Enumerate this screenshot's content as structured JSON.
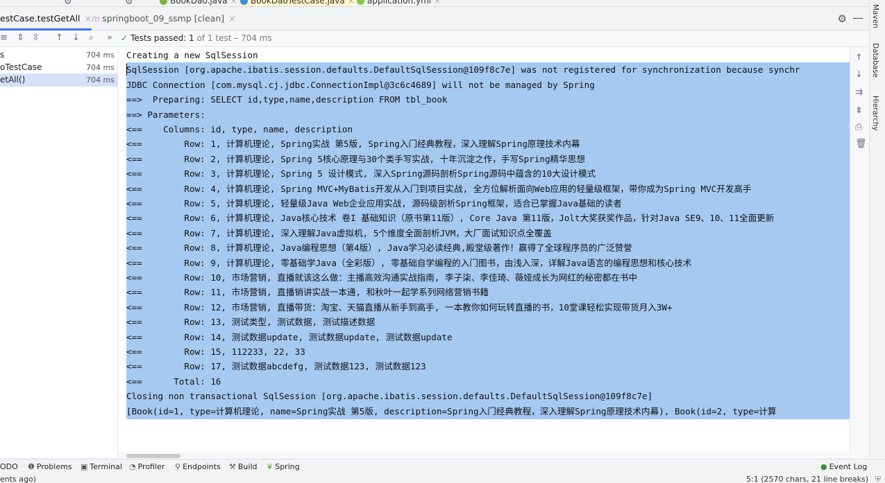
{
  "editor_tabs": [
    "BookDao.java",
    "BookDaoTestCase.java",
    "application.yml"
  ],
  "run_tabs": [
    {
      "label": "estCase.testGetAll"
    },
    {
      "label": "springboot_09_ssmp [clean]"
    }
  ],
  "test_status": {
    "passed_label": "Tests passed:",
    "count": "1",
    "detail": "of 1 test – 704 ms"
  },
  "tree": [
    {
      "name": "s",
      "time": "704 ms"
    },
    {
      "name": "oTestCase",
      "time": "704 ms"
    },
    {
      "name": "etAll()",
      "time": "704 ms"
    }
  ],
  "console_lines": [
    "Creating a new SqlSession",
    "SqlSession [org.apache.ibatis.session.defaults.DefaultSqlSession@109f8c7e] was not registered for synchronization because synchr",
    "JDBC Connection [com.mysql.cj.jdbc.ConnectionImpl@3c6c4689] will not be managed by Spring",
    "==>  Preparing: SELECT id,type,name,description FROM tbl_book",
    "==> Parameters: ",
    "<==    Columns: id, type, name, description",
    "<==        Row: 1, 计算机理论, Spring实战 第5版, Spring入门经典教程，深入理解Spring原理技术内幕",
    "<==        Row: 2, 计算机理论, Spring 5核心原理与30个类手写实战, 十年沉淀之作，手写Spring精华思想",
    "<==        Row: 3, 计算机理论, Spring 5 设计模式, 深入Spring源码剖析Spring源码中蕴含的10大设计模式",
    "<==        Row: 4, 计算机理论, Spring MVC+MyBatis开发从入门到项目实战, 全方位解析面向Web应用的轻量级框架，带你成为Spring MVC开发高手",
    "<==        Row: 5, 计算机理论, 轻量级Java Web企业应用实战, 源码级剖析Spring框架，适合已掌握Java基础的读者",
    "<==        Row: 6, 计算机理论, Java核心技术 卷I 基础知识（原书第11版）, Core Java 第11版，Jolt大奖获奖作品，针对Java SE9、10、11全面更新",
    "<==        Row: 7, 计算机理论, 深入理解Java虚拟机, 5个维度全面剖析JVM，大厂面试知识点全覆盖",
    "<==        Row: 8, 计算机理论, Java编程思想（第4版）, Java学习必读经典,殿堂级著作！赢得了全球程序员的广泛赞誉",
    "<==        Row: 9, 计算机理论, 零基础学Java（全彩版）, 零基础自学编程的入门图书，由浅入深，详解Java语言的编程思想和核心技术",
    "<==        Row: 10, 市场营销, 直播就该这么做：主播高效沟通实战指南, 李子柒、李佳琦、薇娅成长为网红的秘密都在书中",
    "<==        Row: 11, 市场营销, 直播销讲实战一本通, 和秋叶一起学系列网络营销书籍",
    "<==        Row: 12, 市场营销, 直播带货：淘宝、天猫直播从新手到高手, 一本教你如何玩转直播的书，10堂课轻松实现带货月入3W+",
    "<==        Row: 13, 测试类型, 测试数据, 测试描述数据",
    "<==        Row: 14, 测试数据update, 测试数据update, 测试数据update",
    "<==        Row: 15, 112233, 22, 33",
    "<==        Row: 17, 测试数据abcdefg, 测试数据123, 测试数据123",
    "<==      Total: 16",
    "Closing non transactional SqlSession [org.apache.ibatis.session.defaults.DefaultSqlSession@109f8c7e]",
    "[Book(id=1, type=计算机理论, name=Spring实战 第5版, description=Spring入门经典教程，深入理解Spring原理技术内幕), Book(id=2, type=计算"
  ],
  "side_labels": [
    "Maven",
    "Database",
    "Hierarchy"
  ],
  "bottom_tools": [
    "ODO",
    "Problems",
    "Terminal",
    "Profiler",
    "Endpoints",
    "Build",
    "Spring"
  ],
  "event_log": "Event Log",
  "status_left": "ents ago)",
  "status_right": "5:1 (2570 chars, 21 line breaks)",
  "colors": {
    "selection": "#a6c9f2",
    "accent": "#3574f0",
    "pass": "#3a8c3e"
  }
}
